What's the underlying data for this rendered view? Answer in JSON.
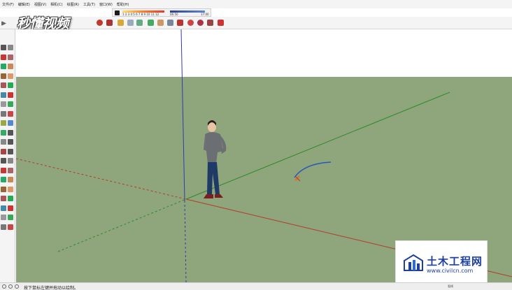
{
  "menu": {
    "items": [
      "文件(F)",
      "编辑(E)",
      "视图(V)",
      "相机(C)",
      "绘图(R)",
      "工具(T)",
      "窗口(W)",
      "帮助(H)"
    ]
  },
  "shadow_bar": {
    "months": "1 2 3 4 5 6 7 8 9 10 11 12",
    "time_start": "06:50",
    "time_end": "17:00"
  },
  "brand": {
    "logo_text": "秒懂视频"
  },
  "status": {
    "hint": "按下鼠标左键并拖动以绘制。",
    "measure_label": "弧线"
  },
  "watermark": {
    "title": "土木工程网",
    "url": "www.civilcn.com"
  },
  "colors": {
    "sky": "#ffffff",
    "ground": "#8fa57c",
    "axis_blue": "#2f3ea8",
    "axis_red": "#b43a2a",
    "axis_green": "#2c8a2c",
    "arc": "#2a58b8",
    "watermark_blue": "#1d3fa0"
  },
  "icons": {
    "toolbar": [
      "select-icon",
      "eraser-icon",
      "paint-bucket-icon",
      "push-pull-icon",
      "move-icon",
      "rotate-icon",
      "offset-icon",
      "tape-measure-icon",
      "text-icon",
      "axes-icon",
      "orbit-icon",
      "pan-icon",
      "zoom-icon",
      "zoom-extents-icon",
      "warehouse-icon",
      "extension-icon"
    ]
  }
}
